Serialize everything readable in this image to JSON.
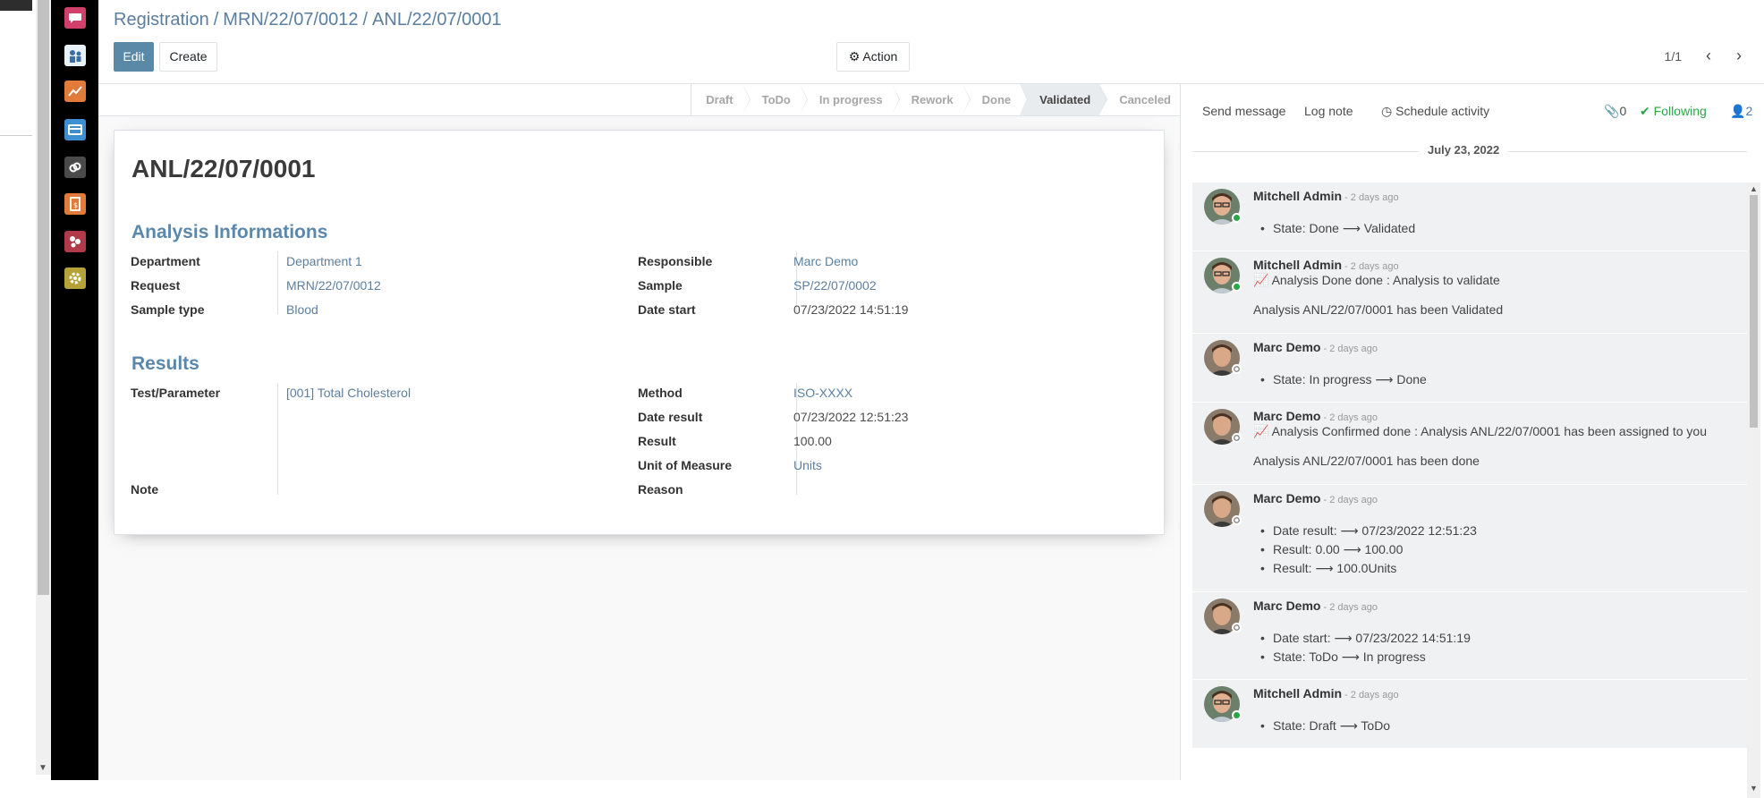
{
  "breadcrumb": {
    "items": [
      "Registration",
      "MRN/22/07/0012"
    ],
    "current": "ANL/22/07/0001",
    "sep": "/"
  },
  "buttons": {
    "edit": "Edit",
    "create": "Create",
    "action": "Action"
  },
  "pager": {
    "value": "1/1"
  },
  "stages": [
    "Draft",
    "ToDo",
    "In progress",
    "Rework",
    "Done",
    "Validated",
    "Canceled"
  ],
  "active_stage": "Validated",
  "record": {
    "name": "ANL/22/07/0001",
    "section1": "Analysis Informations",
    "section2": "Results",
    "fields": {
      "department": {
        "label": "Department",
        "value": "Department 1"
      },
      "request": {
        "label": "Request",
        "value": "MRN/22/07/0012"
      },
      "sample_type": {
        "label": "Sample type",
        "value": "Blood"
      },
      "responsible": {
        "label": "Responsible",
        "value": "Marc Demo"
      },
      "sample": {
        "label": "Sample",
        "value": "SP/22/07/0002"
      },
      "date_start": {
        "label": "Date start",
        "value": "07/23/2022 14:51:19"
      },
      "test": {
        "label": "Test/Parameter",
        "value": "[001] Total Cholesterol"
      },
      "note": {
        "label": "Note",
        "value": ""
      },
      "method": {
        "label": "Method",
        "value": "ISO-XXXX"
      },
      "date_result": {
        "label": "Date result",
        "value": "07/23/2022 12:51:23"
      },
      "result": {
        "label": "Result",
        "value": "100.00"
      },
      "uom": {
        "label": "Unit of Measure",
        "value": "Units"
      },
      "reason": {
        "label": "Reason",
        "value": ""
      }
    }
  },
  "chatter": {
    "send_message": "Send message",
    "log_note": "Log note",
    "schedule": "Schedule activity",
    "attachments": "0",
    "following": "Following",
    "followers": "2",
    "date": "July 23, 2022",
    "messages": [
      {
        "author": "Mitchell Admin",
        "ago": "- 2 days ago",
        "online": true,
        "lines": [],
        "items": [
          "State: Done ⟶ Validated"
        ]
      },
      {
        "author": "Mitchell Admin",
        "ago": "- 2 days ago",
        "online": true,
        "lines": [
          "Analysis Done done : Analysis to validate",
          "Analysis ANL/22/07/0001 has been Validated"
        ],
        "items": []
      },
      {
        "author": "Marc Demo",
        "ago": "- 2 days ago",
        "online": false,
        "lines": [],
        "items": [
          "State: In progress ⟶ Done"
        ]
      },
      {
        "author": "Marc Demo",
        "ago": "- 2 days ago",
        "online": false,
        "lines": [
          "Analysis Confirmed done : Analysis ANL/22/07/0001 has been assigned to you",
          "Analysis ANL/22/07/0001 has been done"
        ],
        "items": []
      },
      {
        "author": "Marc Demo",
        "ago": "- 2 days ago",
        "online": false,
        "lines": [],
        "items": [
          "Date result: ⟶ 07/23/2022 12:51:23",
          "Result: 0.00 ⟶ 100.00",
          "Result: ⟶ 100.0Units"
        ]
      },
      {
        "author": "Marc Demo",
        "ago": "- 2 days ago",
        "online": false,
        "lines": [],
        "items": [
          "Date start: ⟶ 07/23/2022 14:51:19",
          "State: ToDo ⟶ In progress"
        ]
      },
      {
        "author": "Mitchell Admin",
        "ago": "- 2 days ago",
        "online": true,
        "lines": [],
        "items": [
          "State: Draft ⟶ ToDo"
        ]
      }
    ]
  },
  "colors": {
    "primary": "#5a89a8",
    "link": "#5a7fa0",
    "following": "#28a745"
  },
  "appbar_icons": [
    "discuss-icon",
    "patients-icon",
    "reporting-icon",
    "billing-icon",
    "links-icon",
    "documents-icon",
    "lab-icon",
    "settings-icon"
  ]
}
